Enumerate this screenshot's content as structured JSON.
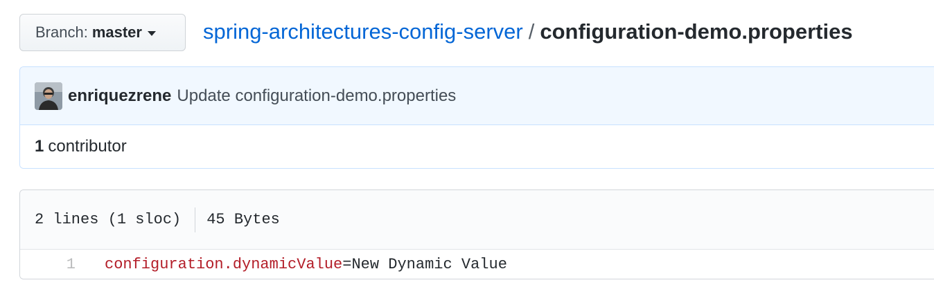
{
  "branch": {
    "prefix": "Branch:",
    "name": "master",
    "caret_icon": "caret-down-icon"
  },
  "breadcrumb": {
    "repo": "spring-architectures-config-server",
    "separator": "/",
    "file": "configuration-demo.properties"
  },
  "commit": {
    "avatar_icon": "user-avatar",
    "author": "enriquezrene",
    "message": "Update configuration-demo.properties"
  },
  "contributors": {
    "count": "1",
    "label": "contributor"
  },
  "file_info": {
    "lines": "2 lines (1 sloc)",
    "size": "45 Bytes"
  },
  "code": {
    "lines": [
      {
        "number": "1",
        "key": "configuration.dynamicValue",
        "operator": "=",
        "value": "New Dynamic Value"
      }
    ]
  },
  "colors": {
    "link": "#0366d6",
    "commit_bg": "#f1f8ff",
    "commit_border": "#c8e1ff",
    "key_color": "#b31d28"
  }
}
